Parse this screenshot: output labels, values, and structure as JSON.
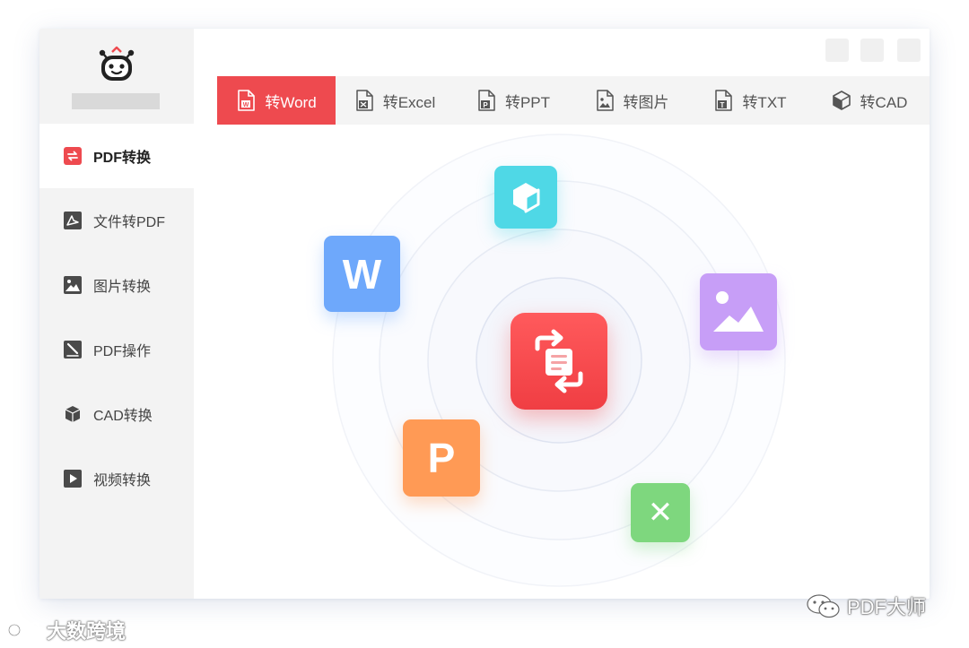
{
  "sidebar": {
    "items": [
      {
        "label": "PDF转换",
        "icon": "convert-icon",
        "active": true
      },
      {
        "label": "文件转PDF",
        "icon": "acrobat-icon"
      },
      {
        "label": "图片转换",
        "icon": "image-icon"
      },
      {
        "label": "PDF操作",
        "icon": "edit-pen-icon"
      },
      {
        "label": "CAD转换",
        "icon": "cube-icon"
      },
      {
        "label": "视频转换",
        "icon": "play-icon"
      }
    ]
  },
  "tabs": [
    {
      "label": "转Word",
      "icon": "word-file-icon",
      "active": true
    },
    {
      "label": "转Excel",
      "icon": "excel-file-icon"
    },
    {
      "label": "转PPT",
      "icon": "ppt-file-icon"
    },
    {
      "label": "转图片",
      "icon": "image-file-icon"
    },
    {
      "label": "转TXT",
      "icon": "txt-file-icon"
    },
    {
      "label": "转CAD",
      "icon": "cad-cube-icon"
    }
  ],
  "illustration": {
    "word_letter": "W",
    "ppt_letter": "P",
    "excel_letter": "✕",
    "colors": {
      "accent": "#ee4a4f",
      "word": "#6ea8fb",
      "ppt": "#ff9a55",
      "excel": "#7ed77e",
      "image": "#c79ef7",
      "cad": "#4fd8e6"
    }
  },
  "watermarks": {
    "left": "大数跨境",
    "right": "PDF大师"
  }
}
